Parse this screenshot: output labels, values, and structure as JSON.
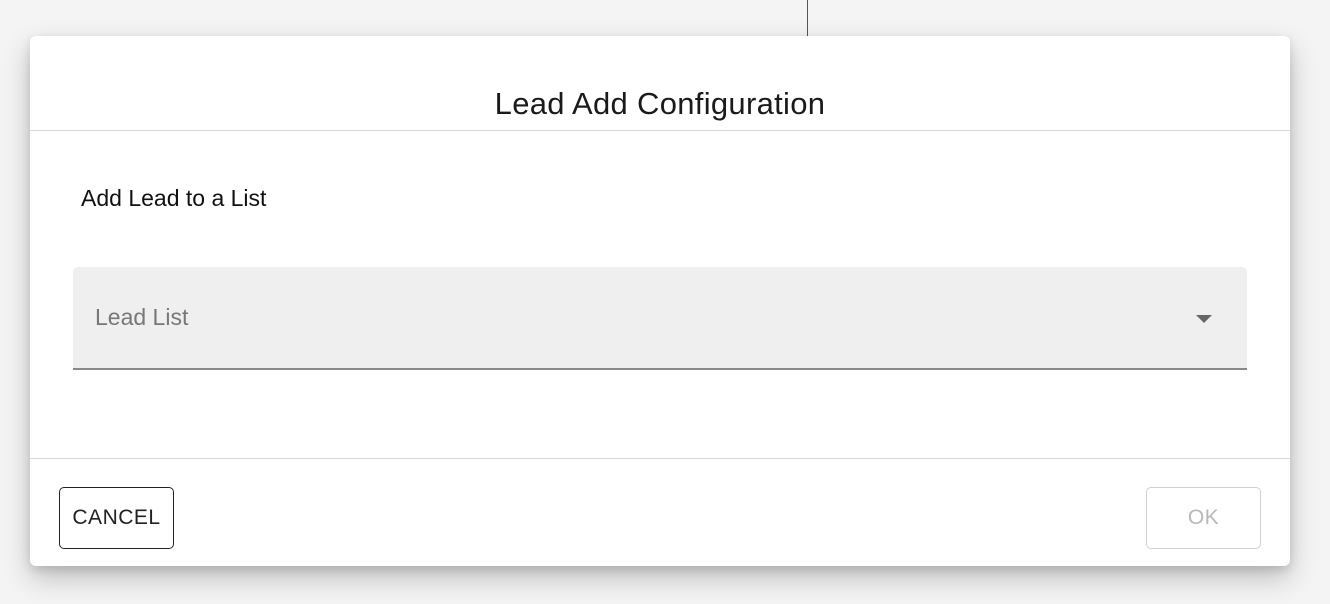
{
  "dialog": {
    "title": "Lead Add Configuration",
    "section_heading": "Add Lead to a List",
    "lead_list_select": {
      "label": "Lead List",
      "selected_value": "",
      "icon": "chevron-down-icon"
    },
    "footer": {
      "cancel_label": "CANCEL",
      "ok_label": "OK",
      "ok_disabled": true
    }
  }
}
